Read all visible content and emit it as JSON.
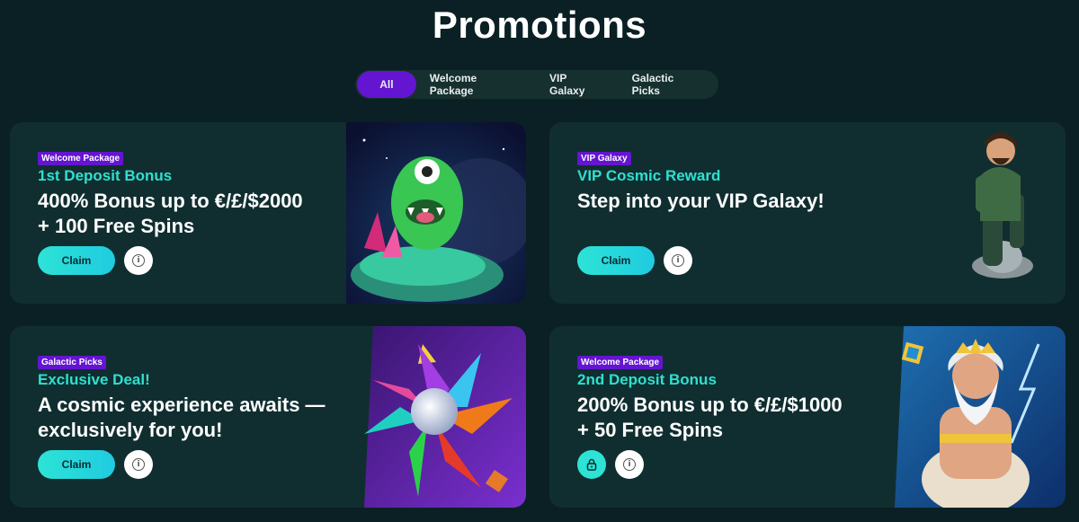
{
  "page": {
    "title": "Promotions"
  },
  "tabs": [
    {
      "label": "All",
      "active": true
    },
    {
      "label": "Welcome Package",
      "active": false
    },
    {
      "label": "VIP Galaxy",
      "active": false
    },
    {
      "label": "Galactic Picks",
      "active": false
    }
  ],
  "promos": [
    {
      "badge": "Welcome Package",
      "subtitle": "1st Deposit Bonus",
      "headline_line1": "400% Bonus up to €/£/$2000",
      "headline_line2": "+ 100 Free Spins",
      "claim_label": "Claim",
      "art_icon": "green-alien-monster-icon"
    },
    {
      "badge": "VIP Galaxy",
      "subtitle": "VIP Cosmic Reward",
      "headline_line1": "Step into your VIP Galaxy!",
      "claim_label": "Claim",
      "art_icon": "explorer-character-icon"
    },
    {
      "badge": "Galactic Picks",
      "subtitle": "Exclusive Deal!",
      "headline_line1": "A cosmic experience awaits —",
      "headline_line2": "exclusively for you!",
      "claim_label": "Claim",
      "art_icon": "gem-star-icon"
    },
    {
      "badge": "Welcome Package",
      "subtitle": "2nd Deposit Bonus",
      "headline_line1": "200% Bonus up to €/£/$1000",
      "headline_line2": "+ 50 Free Spins",
      "locked": true,
      "art_icon": "zeus-character-icon"
    }
  ],
  "colors": {
    "background": "#0b2024",
    "card": "#102e30",
    "accent_purple": "#6415d1",
    "accent_teal": "#2fe0cf"
  },
  "icons": {
    "info": "info-icon",
    "lock": "lock-icon"
  }
}
